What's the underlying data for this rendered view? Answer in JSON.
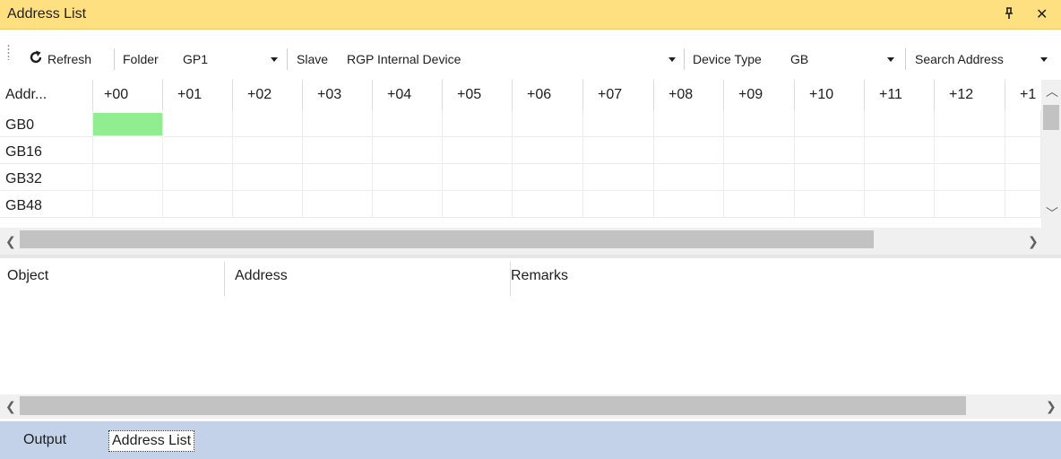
{
  "window": {
    "title": "Address List",
    "pin_glyph": "⊥",
    "close_glyph": "✕"
  },
  "toolbar": {
    "refresh_label": "Refresh",
    "folder_label": "Folder",
    "folder_value": "GP1",
    "slave_label": "Slave",
    "slave_value": "RGP Internal Device",
    "device_type_label": "Device Type",
    "device_type_value": "GB",
    "search_label": "Search Address"
  },
  "grid": {
    "header_first": "Addr...",
    "columns": [
      "+00",
      "+01",
      "+02",
      "+03",
      "+04",
      "+05",
      "+06",
      "+07",
      "+08",
      "+09",
      "+10",
      "+11",
      "+12",
      "+1"
    ],
    "rows": [
      "GB0",
      "GB16",
      "GB32",
      "GB48"
    ],
    "highlight_color": "#90ee90"
  },
  "list": {
    "columns": [
      "Object",
      "Address",
      "Remarks"
    ]
  },
  "tabs": [
    {
      "label": "Output"
    },
    {
      "label": "Address List"
    }
  ],
  "colors": {
    "title_bar": "#ffe081",
    "tab_bar": "#c3d2e8"
  }
}
